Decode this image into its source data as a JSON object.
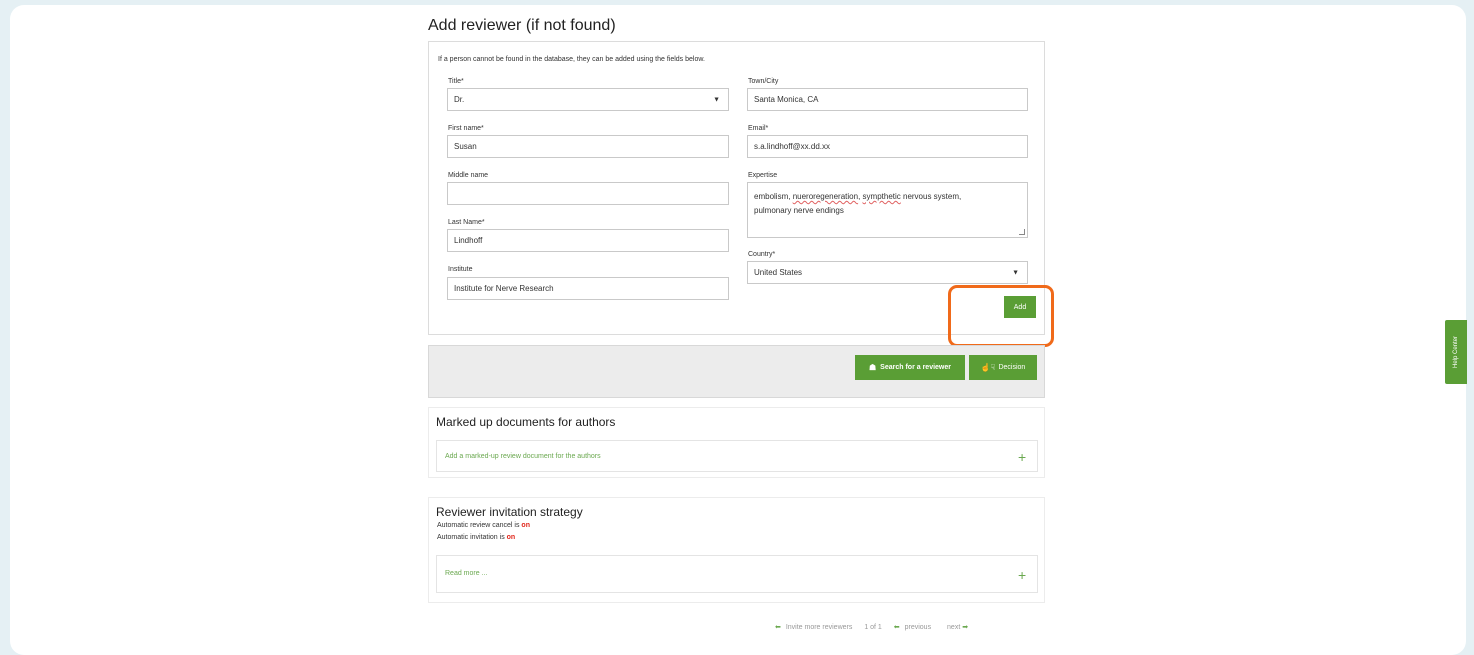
{
  "form": {
    "title": "Add reviewer (if not found)",
    "intro": "If a person cannot be found in the database, they can be added using the fields below.",
    "title_label": "Title*",
    "title_value": "Dr.",
    "first_name_label": "First name*",
    "first_name_value": "Susan",
    "middle_name_label": "Middle name",
    "middle_name_value": "",
    "last_name_label": "Last Name*",
    "last_name_value": "Lindhoff",
    "institute_label": "Institute",
    "institute_value": "Institute for Nerve Research",
    "town_label": "Town/City",
    "town_value": "Santa Monica, CA",
    "email_label": "Email*",
    "email_value": "s.a.lindhoff@xx.dd.xx",
    "expertise_label": "Expertise",
    "expertise_part1": "embolism, ",
    "expertise_part2": "nueroregeneration",
    "expertise_part3": ", ",
    "expertise_part4": "sympthetic",
    "expertise_part5": " nervous system,",
    "expertise_line2": "pulmonary nerve endings",
    "country_label": "Country*",
    "country_value": "United States",
    "add_label": "Add"
  },
  "actions": {
    "search_label": "Search for a reviewer",
    "decision_label": "Decision"
  },
  "marked_up": {
    "title": "Marked up documents for authors",
    "link": "Add a marked-up review document for the authors",
    "plus": "+"
  },
  "strategy": {
    "title": "Reviewer invitation strategy",
    "cancel_text": "Automatic review cancel is ",
    "cancel_state": "on",
    "invite_text": "Automatic invitation is ",
    "invite_state": "on",
    "read_more": "Read more ...",
    "plus": "+"
  },
  "pager": {
    "invite_more": "Invite more reviewers",
    "page": "1 of 1",
    "previous": "previous",
    "next": "next"
  },
  "help_tab": "Help Center",
  "colors": {
    "accent_green": "#5a9e35",
    "highlight_orange": "#f06a1a",
    "status_on_red": "#e0261b"
  }
}
